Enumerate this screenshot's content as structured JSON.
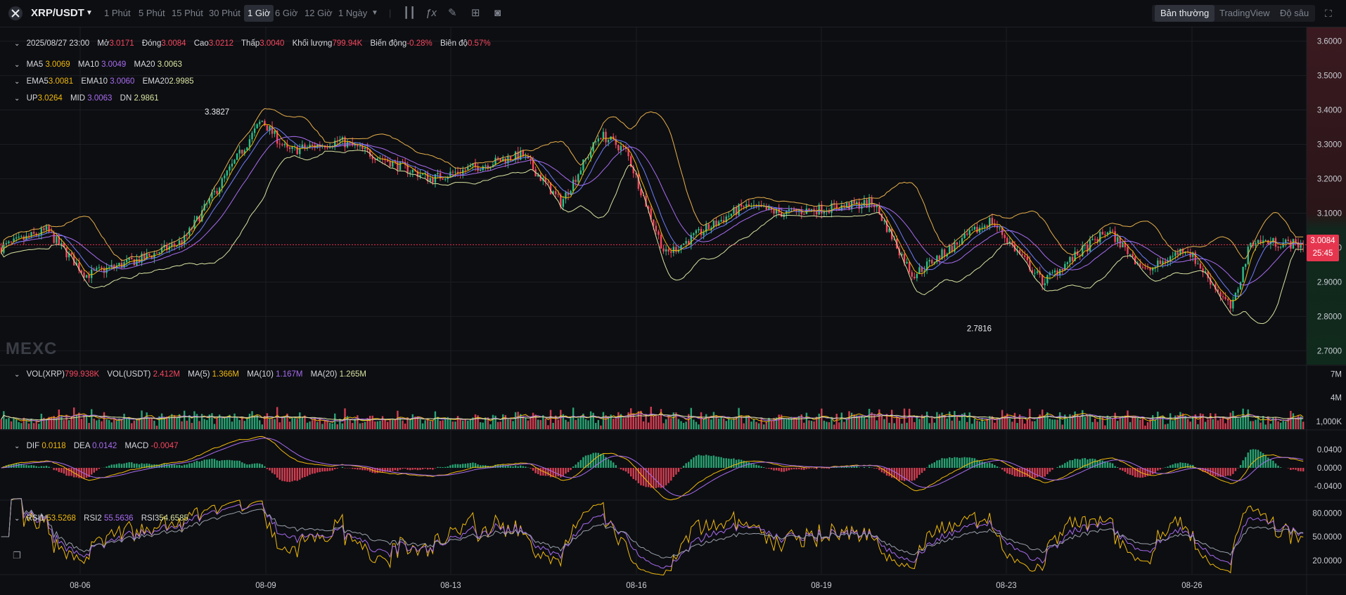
{
  "topbar": {
    "pair": "XRP/USDT",
    "intervals": [
      "1 Phút",
      "5 Phút",
      "15 Phút",
      "30 Phút",
      "1 Giờ",
      "6 Giờ",
      "12 Giờ",
      "1 Ngày"
    ],
    "active_interval": "1 Giờ",
    "views": [
      "Bản thường",
      "TradingView",
      "Độ sâu"
    ],
    "active_view": "Bản thường"
  },
  "legend": {
    "ohlc": {
      "date": "2025/08/27 23:00",
      "open_label": "Mở",
      "open": "3.0171",
      "close_label": "Đóng",
      "close": "3.0084",
      "high_label": "Cao",
      "high": "3.0212",
      "low_label": "Thấp",
      "low": "3.0040",
      "vol_label": "Khối lượng",
      "vol": "799.94K",
      "chg_label": "Biến động",
      "chg": "-0.28%",
      "amp_label": "Biên độ",
      "amp": "0.57%"
    },
    "ma": {
      "ma5_label": "MA5",
      "ma5": "3.0069",
      "ma10_label": "MA10",
      "ma10": "3.0049",
      "ma20_label": "MA20",
      "ma20": "3.0063"
    },
    "ema": {
      "ema5_label": "EMA5",
      "ema5": "3.0081",
      "ema10_label": "EMA10",
      "ema10": "3.0060",
      "ema20_label": "EMA20",
      "ema20": "2.9985"
    },
    "boll": {
      "up_label": "UP",
      "up": "3.0264",
      "mid_label": "MID",
      "mid": "3.0063",
      "dn_label": "DN",
      "dn": "2.9861"
    },
    "vol": {
      "vxrp_label": "VOL(XRP)",
      "vxrp": "799.938K",
      "vusdt_label": "VOL(USDT)",
      "vusdt": "2.412M",
      "ma5_label": "MA(5)",
      "ma5": "1.366M",
      "ma10_label": "MA(10)",
      "ma10": "1.167M",
      "ma20_label": "MA(20)",
      "ma20": "1.265M"
    },
    "macd": {
      "dif_label": "DIF",
      "dif": "0.0118",
      "dea_label": "DEA",
      "dea": "0.0142",
      "macd_label": "MACD",
      "macd": "-0.0047"
    },
    "rsi": {
      "rsi1_label": "RSI1",
      "rsi1": "53.5268",
      "rsi2_label": "RSI2",
      "rsi2": "55.5636",
      "rsi3_label": "RSI3",
      "rsi3": "54.6585"
    }
  },
  "watermark": "MEXC",
  "current_price": "3.0084",
  "countdown": "25:45",
  "colors": {
    "up": "#2ebd85",
    "down": "#f6465d",
    "ma5": "#f0b90b",
    "ma10": "#a86cf0",
    "ma20": "#d8e3a0",
    "boll": "#e8b04a",
    "bg": "#0d0e12",
    "grid": "#1b1d23"
  },
  "chart_data": [
    {
      "type": "candlestick",
      "panel": "price",
      "ylim": [
        2.66,
        3.64
      ],
      "yticks": [
        "3.6000",
        "3.5000",
        "3.4000",
        "3.3000",
        "3.2000",
        "3.1000",
        "3.0000",
        "2.9000",
        "2.8000",
        "2.7000"
      ],
      "ytick_values": [
        3.6,
        3.5,
        3.4,
        3.3,
        3.2,
        3.1,
        3.0,
        2.9,
        2.8,
        2.7
      ],
      "xlabels": [
        "08-06",
        "08-09",
        "08-13",
        "08-16",
        "08-19",
        "08-23",
        "08-26"
      ],
      "annotations": [
        {
          "text": "3.3827",
          "value": 3.3827,
          "date": "08-07"
        },
        {
          "text": "2.7816",
          "value": 2.7816,
          "date": "08-22"
        }
      ],
      "keypoints_x": [
        0,
        0.035,
        0.065,
        0.11,
        0.14,
        0.2,
        0.22,
        0.26,
        0.33,
        0.4,
        0.43,
        0.46,
        0.48,
        0.51,
        0.57,
        0.6,
        0.67,
        0.7,
        0.76,
        0.8,
        0.85,
        0.88,
        0.91,
        0.945,
        0.96,
        1.0
      ],
      "keypoints_close": [
        3.0,
        3.05,
        2.92,
        2.97,
        3.02,
        3.37,
        3.28,
        3.31,
        3.2,
        3.27,
        3.13,
        3.33,
        3.28,
        2.98,
        3.12,
        3.1,
        3.13,
        2.92,
        3.08,
        2.9,
        3.05,
        2.93,
        3.0,
        2.82,
        3.02,
        3.0084
      ]
    },
    {
      "type": "bar",
      "panel": "volume",
      "yticks": [
        "7M",
        "4M",
        "1,000K"
      ],
      "ytick_values": [
        7,
        4,
        1
      ]
    },
    {
      "type": "histogram",
      "panel": "macd",
      "yticks": [
        "0.0400",
        "0.0000",
        "-0.0400"
      ],
      "ytick_values": [
        0.04,
        0,
        -0.04
      ]
    },
    {
      "type": "line",
      "panel": "rsi",
      "yticks": [
        "80.0000",
        "50.0000",
        "20.0000"
      ],
      "ytick_values": [
        80,
        50,
        20
      ]
    }
  ]
}
